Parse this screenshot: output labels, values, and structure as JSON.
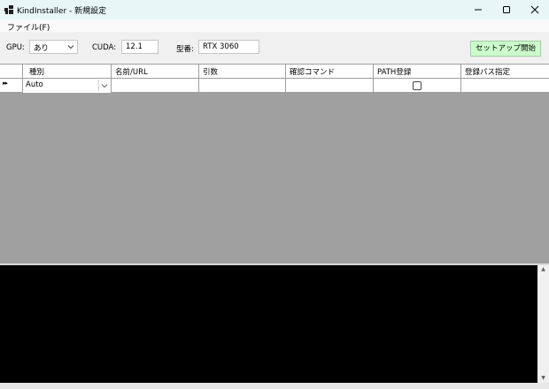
{
  "window": {
    "title": "KindInstaller - 新規設定",
    "icon": "app-windows-icon",
    "controls": [
      "minimize-icon",
      "maximize-icon",
      "close-icon"
    ]
  },
  "menu": {
    "file": "ファイル(F)"
  },
  "toolbar": {
    "gpu_label": "GPU:",
    "gpu_value": "あり",
    "cuda_label": "CUDA:",
    "cuda_value": "12.1",
    "model_label": "型番:",
    "model_value": "RTX 3060",
    "setup_button": "セットアップ開始",
    "setup_button_color": "#ccffcc"
  },
  "grid": {
    "columns": [
      "種別",
      "名前/URL",
      "引数",
      "確認コマンド",
      "PATH登録",
      "登録パス指定"
    ],
    "rows": [
      {
        "indicator": "▸▸",
        "type": "Auto",
        "name_url": "",
        "args": "",
        "check_command": "",
        "path_register": false,
        "path_spec": ""
      }
    ],
    "background_color": "#a0a0a0"
  },
  "console": {
    "background_color": "#000000"
  }
}
